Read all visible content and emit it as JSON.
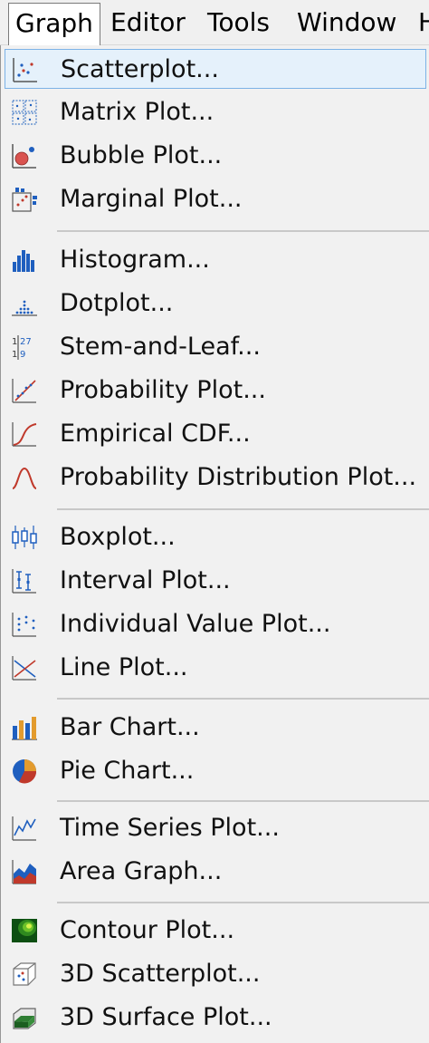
{
  "menubar": {
    "items": [
      {
        "label": "Graph",
        "active": true
      },
      {
        "label": "Editor",
        "active": false
      },
      {
        "label": "Tools",
        "active": false
      },
      {
        "label": "Window",
        "active": false
      },
      {
        "label": "H",
        "active": false
      }
    ]
  },
  "menu": {
    "items": [
      {
        "label": "Scatterplot...",
        "icon": "scatterplot-icon",
        "highlighted": true
      },
      {
        "label": "Matrix Plot...",
        "icon": "matrix-plot-icon"
      },
      {
        "label": "Bubble Plot...",
        "icon": "bubble-plot-icon"
      },
      {
        "label": "Marginal Plot...",
        "icon": "marginal-plot-icon"
      },
      {
        "label": "Histogram...",
        "icon": "histogram-icon"
      },
      {
        "label": "Dotplot...",
        "icon": "dotplot-icon"
      },
      {
        "label": "Stem-and-Leaf...",
        "icon": "stem-and-leaf-icon"
      },
      {
        "label": "Probability Plot...",
        "icon": "probability-plot-icon"
      },
      {
        "label": "Empirical CDF...",
        "icon": "empirical-cdf-icon"
      },
      {
        "label": "Probability Distribution Plot...",
        "icon": "probability-distribution-icon"
      },
      {
        "label": "Boxplot...",
        "icon": "boxplot-icon"
      },
      {
        "label": "Interval Plot...",
        "icon": "interval-plot-icon"
      },
      {
        "label": "Individual Value Plot...",
        "icon": "individual-value-plot-icon"
      },
      {
        "label": "Line Plot...",
        "icon": "line-plot-icon"
      },
      {
        "label": "Bar Chart...",
        "icon": "bar-chart-icon"
      },
      {
        "label": "Pie Chart...",
        "icon": "pie-chart-icon"
      },
      {
        "label": "Time Series Plot...",
        "icon": "time-series-icon"
      },
      {
        "label": "Area Graph...",
        "icon": "area-graph-icon"
      },
      {
        "label": "Contour Plot...",
        "icon": "contour-plot-icon"
      },
      {
        "label": "3D Scatterplot...",
        "icon": "3d-scatterplot-icon"
      },
      {
        "label": "3D Surface Plot...",
        "icon": "3d-surface-plot-icon"
      }
    ]
  },
  "colors": {
    "highlight_bg": "#e5f1fb",
    "highlight_border": "#7cb2e6",
    "icon_blue": "#1f5fbf",
    "icon_red": "#c0392b"
  }
}
